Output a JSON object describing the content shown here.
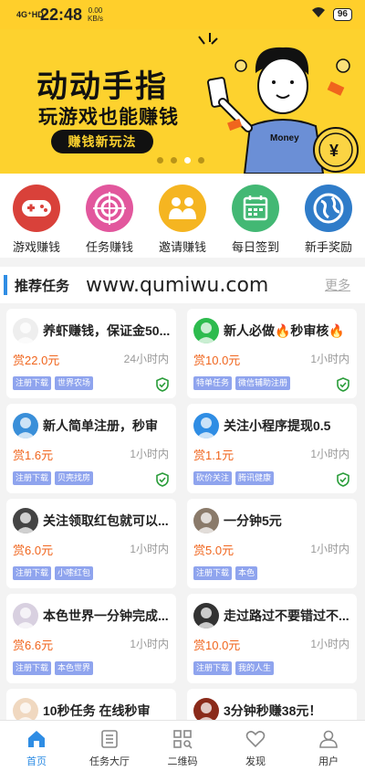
{
  "status_bar": {
    "signal": "4G⁺HD",
    "time": "22:48",
    "speed_value": "0.00",
    "speed_unit": "KB/s",
    "battery": "96"
  },
  "banner": {
    "title": "动动手指",
    "subtitle": "玩游戏也能赚钱",
    "button": "赚钱新玩法",
    "shirt_text": "Money",
    "coin_symbol": "¥",
    "slides": 4,
    "active_slide": 3
  },
  "categories": [
    {
      "label": "游戏赚钱",
      "icon": "gamepad-icon",
      "color": "#d9413a"
    },
    {
      "label": "任务赚钱",
      "icon": "target-icon",
      "color": "#e2579d"
    },
    {
      "label": "邀请赚钱",
      "icon": "invite-people-icon",
      "color": "#f5b521"
    },
    {
      "label": "每日签到",
      "icon": "calendar-icon",
      "color": "#43b874"
    },
    {
      "label": "新手奖励",
      "icon": "globe-icon",
      "color": "#2f7cc9"
    }
  ],
  "section": {
    "title": "推荐任务",
    "watermark": "www.qumiwu.com",
    "more": "更多"
  },
  "tasks": [
    {
      "title": "养虾赚钱，保证金50...",
      "reward": "赏22.0元",
      "time": "24小时内",
      "tags": [
        "注册下载",
        "世界农场"
      ],
      "verified": true,
      "avatar": "shrimp-avatar",
      "avatar_color": "#eeeeee"
    },
    {
      "title": "新人必做🔥秒审核🔥",
      "reward": "赏10.0元",
      "time": "1小时内",
      "tags": [
        "特单任务",
        "微信辅助注册"
      ],
      "verified": true,
      "avatar": "wechat-icon",
      "avatar_color": "#2dbb4e"
    },
    {
      "title": "新人简单注册，秒审",
      "reward": "赏1.6元",
      "time": "1小时内",
      "tags": [
        "注册下载",
        "贝壳找房"
      ],
      "verified": true,
      "avatar": "doraemon-avatar",
      "avatar_color": "#3a8fd9"
    },
    {
      "title": "关注小程序提现0.5",
      "reward": "赏1.1元",
      "time": "1小时内",
      "tags": [
        "砍价关注",
        "腾讯健康"
      ],
      "verified": true,
      "avatar": "tencent-health-icon",
      "avatar_color": "#2f8de4"
    },
    {
      "title": "关注领取红包就可以...",
      "reward": "赏6.0元",
      "time": "1小时内",
      "tags": [
        "注册下载",
        "小嗦红包"
      ],
      "verified": false,
      "avatar": "dark-avatar",
      "avatar_color": "#444444"
    },
    {
      "title": "一分钟5元",
      "reward": "赏5.0元",
      "time": "1小时内",
      "tags": [
        "注册下载",
        "本色"
      ],
      "verified": false,
      "avatar": "photo-avatar",
      "avatar_color": "#8a7a6a"
    },
    {
      "title": "本色世界一分钟完成...",
      "reward": "赏6.6元",
      "time": "1小时内",
      "tags": [
        "注册下载",
        "本色世界"
      ],
      "verified": false,
      "avatar": "anime-avatar",
      "avatar_color": "#d8d0e0"
    },
    {
      "title": "走过路过不要错过不...",
      "reward": "赏10.0元",
      "time": "1小时内",
      "tags": [
        "注册下载",
        "我的人生"
      ],
      "verified": false,
      "avatar": "person-avatar",
      "avatar_color": "#333333"
    },
    {
      "title": "10秒任务 在线秒审",
      "reward": "",
      "time": "",
      "tags": [],
      "verified": false,
      "avatar": "anime-avatar",
      "avatar_color": "#f0d8c0"
    },
    {
      "title": "3分钟秒赚38元！",
      "reward": "",
      "time": "",
      "tags": [],
      "verified": false,
      "avatar": "calligraphy-avatar",
      "avatar_color": "#8a2a1a"
    }
  ],
  "nav": [
    {
      "label": "首页",
      "icon": "home-icon",
      "active": true
    },
    {
      "label": "任务大厅",
      "icon": "task-list-icon",
      "active": false
    },
    {
      "label": "二维码",
      "icon": "qr-code-icon",
      "active": false
    },
    {
      "label": "发现",
      "icon": "heart-icon",
      "active": false
    },
    {
      "label": "用户",
      "icon": "user-icon",
      "active": false
    }
  ],
  "colors": {
    "accent": "#2f8de4",
    "reward": "#f0651d",
    "banner_yellow": "#fdd22e",
    "tag": "#8fa4ee",
    "verified": "#2a9d3a"
  }
}
